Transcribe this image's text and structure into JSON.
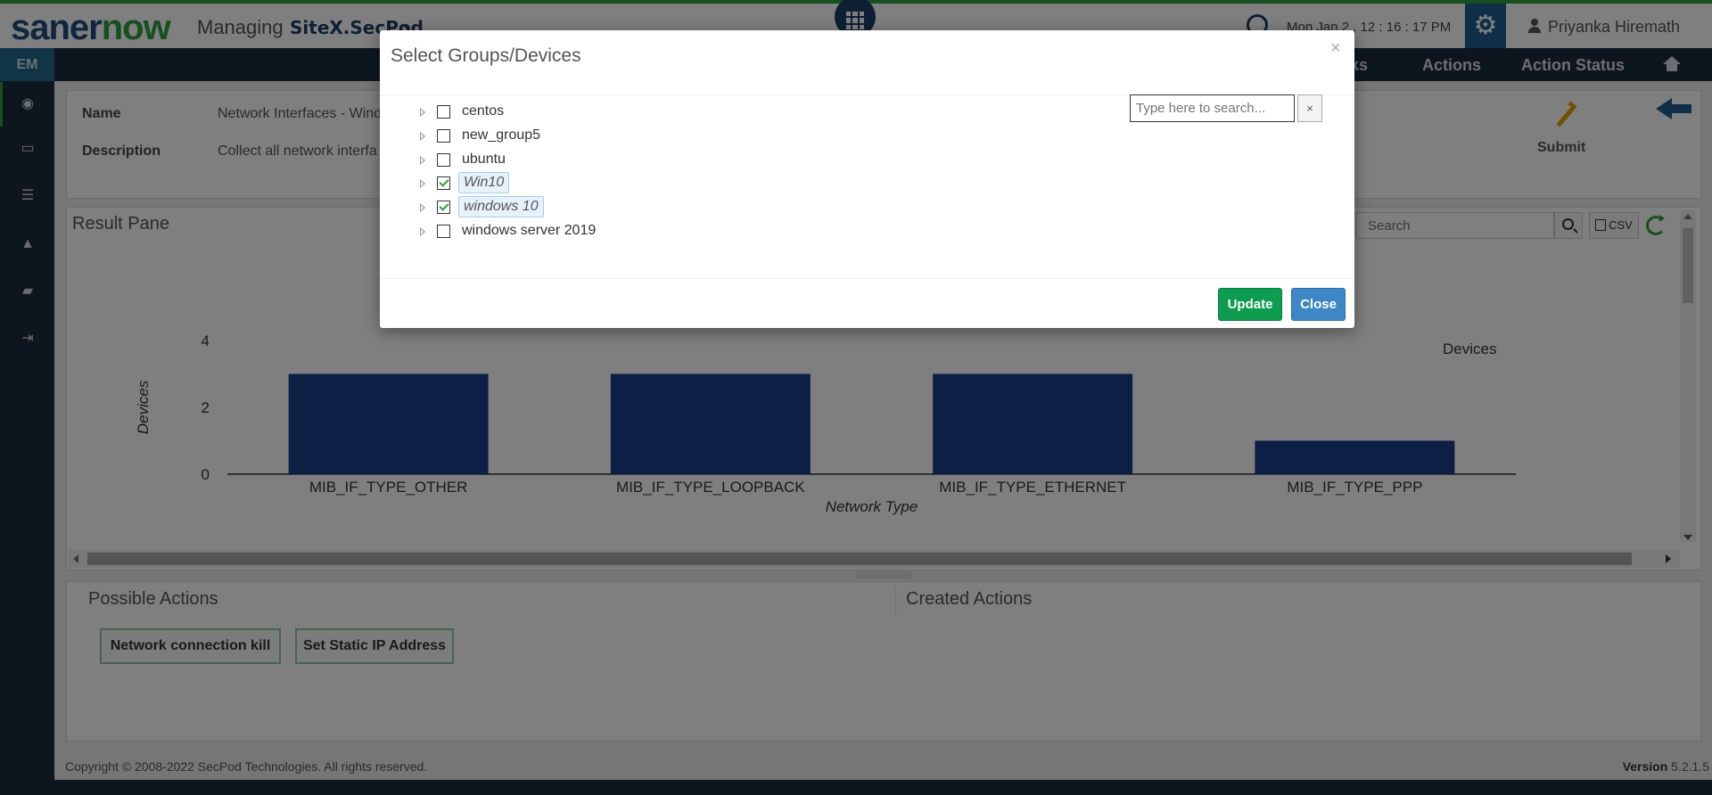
{
  "header": {
    "logo_part1": "saner",
    "logo_part2": "now",
    "managing_label": "Managing",
    "site_name": "SiteX.SecPod",
    "datetime": "Mon Jan 2 , 12 : 16 : 17 PM",
    "user_name": "Priyanka Hiremath"
  },
  "nav": {
    "em_tab": "EM",
    "items": [
      "cks",
      "Actions",
      "Action Status"
    ]
  },
  "sidebar": {
    "icons": [
      "eye-icon",
      "monitor-icon",
      "list-icon",
      "alert-icon",
      "book-icon",
      "logout-icon"
    ]
  },
  "info": {
    "name_label": "Name",
    "name_value": "Network Interfaces - Wind",
    "description_label": "Description",
    "description_value": "Collect all network interfa",
    "submit_label": "Submit"
  },
  "result": {
    "title": "Result Pane",
    "search_placeholder": "Search",
    "csv_label": "CSV"
  },
  "chart_data": {
    "type": "bar",
    "categories": [
      "MIB_IF_TYPE_OTHER",
      "MIB_IF_TYPE_LOOPBACK",
      "MIB_IF_TYPE_ETHERNET",
      "MIB_IF_TYPE_PPP"
    ],
    "series": [
      {
        "name": "Devices",
        "values": [
          3,
          3,
          3,
          1
        ]
      }
    ],
    "xlabel": "Network Type",
    "ylabel": "Devices",
    "ylim": [
      0,
      4
    ],
    "yticks": [
      0,
      2,
      4
    ],
    "legend": "top-right",
    "grid": false,
    "bar_color": "#1c3f8c"
  },
  "actions": {
    "possible_title": "Possible Actions",
    "created_title": "Created Actions",
    "buttons": [
      "Network connection kill",
      "Set Static IP Address"
    ]
  },
  "footer": {
    "copyright": "Copyright © 2008-2022 SecPod Technologies. All rights reserved.",
    "version_label": "Version",
    "version_value": "5.2.1.5"
  },
  "modal": {
    "title": "Select Groups/Devices",
    "close_glyph": "×",
    "search_placeholder": "Type here to search...",
    "search_clear": "×",
    "tree": [
      {
        "label": "centos",
        "checked": false,
        "selected": false
      },
      {
        "label": "new_group5",
        "checked": false,
        "selected": false
      },
      {
        "label": "ubuntu",
        "checked": false,
        "selected": false
      },
      {
        "label": "Win10",
        "checked": true,
        "selected": true
      },
      {
        "label": "windows 10",
        "checked": true,
        "selected": true
      },
      {
        "label": "windows server 2019",
        "checked": false,
        "selected": false
      }
    ],
    "update_label": "Update",
    "close_label": "Close"
  },
  "colors": {
    "brand_blue": "#1d4e7c",
    "brand_green": "#2ea03e",
    "nav_dark": "#1b2d3e",
    "update_green": "#0d9c50",
    "close_blue": "#3d87c6"
  }
}
